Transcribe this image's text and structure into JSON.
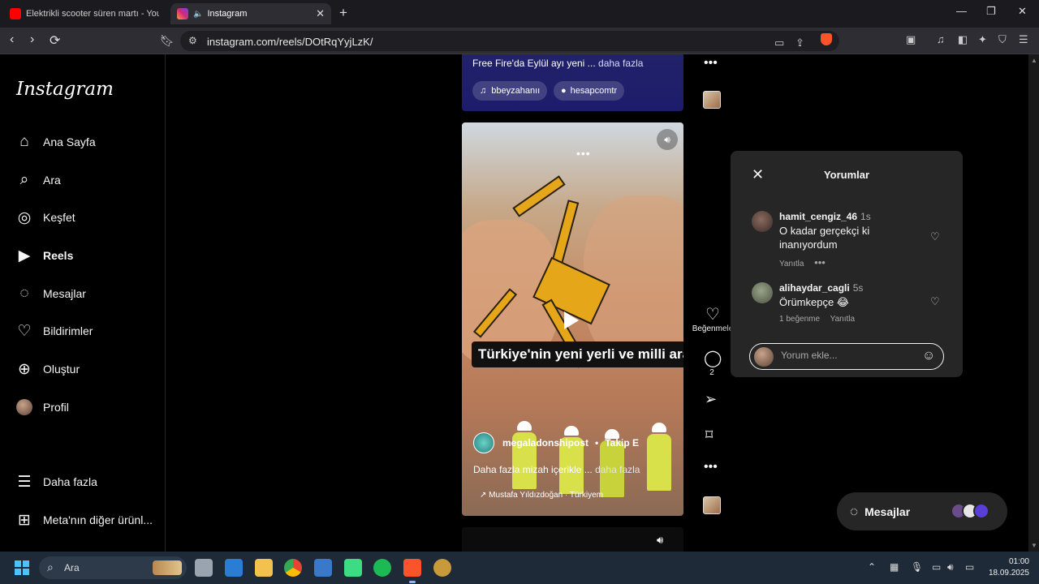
{
  "browser": {
    "tabs": [
      {
        "title": "Elektrikli scooter süren martı - YouTube",
        "active": false,
        "favicon": "youtube-icon"
      },
      {
        "title": "Instagram",
        "active": true,
        "favicon": "instagram-icon"
      }
    ],
    "url": "instagram.com/reels/DOtRqYyjLzK/"
  },
  "sidebar": {
    "logo": "Instagram",
    "items": [
      {
        "label": "Ana Sayfa",
        "icon": "home-icon"
      },
      {
        "label": "Ara",
        "icon": "search-icon"
      },
      {
        "label": "Keşfet",
        "icon": "compass-icon"
      },
      {
        "label": "Reels",
        "icon": "reels-icon",
        "active": true
      },
      {
        "label": "Mesajlar",
        "icon": "messenger-icon"
      },
      {
        "label": "Bildirimler",
        "icon": "heart-icon"
      },
      {
        "label": "Oluştur",
        "icon": "plus-square-icon"
      },
      {
        "label": "Profil",
        "icon": "avatar"
      }
    ],
    "more": "Daha fazla",
    "meta": "Meta'nın diğer ürünl..."
  },
  "prev_reel": {
    "caption": "Free Fire'da Eylül ayı yeni ...",
    "more": "daha fazla",
    "chips": [
      "bbeyzahanıı",
      "hesapcomtr"
    ]
  },
  "reel": {
    "banner": "Türkiye'nin yeni yerli ve milli aracı 👏",
    "author": "megaladonshipost",
    "follow": "Takip E",
    "description": "Daha fazla mizah içerikle ...",
    "more": "daha fazla",
    "audio": "Mustafa Yıldızdoğan · Türkiyem"
  },
  "actions": {
    "like_label": "Beğenmele",
    "comment_count": "2"
  },
  "comments_panel": {
    "title": "Yorumlar",
    "comments": [
      {
        "user": "hamit_cengiz_46",
        "time": "1s",
        "text": "O kadar gerçekçi ki inanıyordum",
        "reply": "Yanıtla",
        "likes": ""
      },
      {
        "user": "alihaydar_cagli",
        "time": "5s",
        "text": "Örümkepçe 😂",
        "reply": "Yanıtla",
        "likes": "1 beğenme"
      }
    ],
    "input_placeholder": "Yorum ekle..."
  },
  "messages_button": "Mesajlar",
  "taskbar": {
    "search": "Ara",
    "time": "01:00",
    "date": "18.09.2025"
  },
  "colors": {
    "brave": "#fb542b",
    "panel": "#262626",
    "taskbar": "#1f2a38"
  }
}
